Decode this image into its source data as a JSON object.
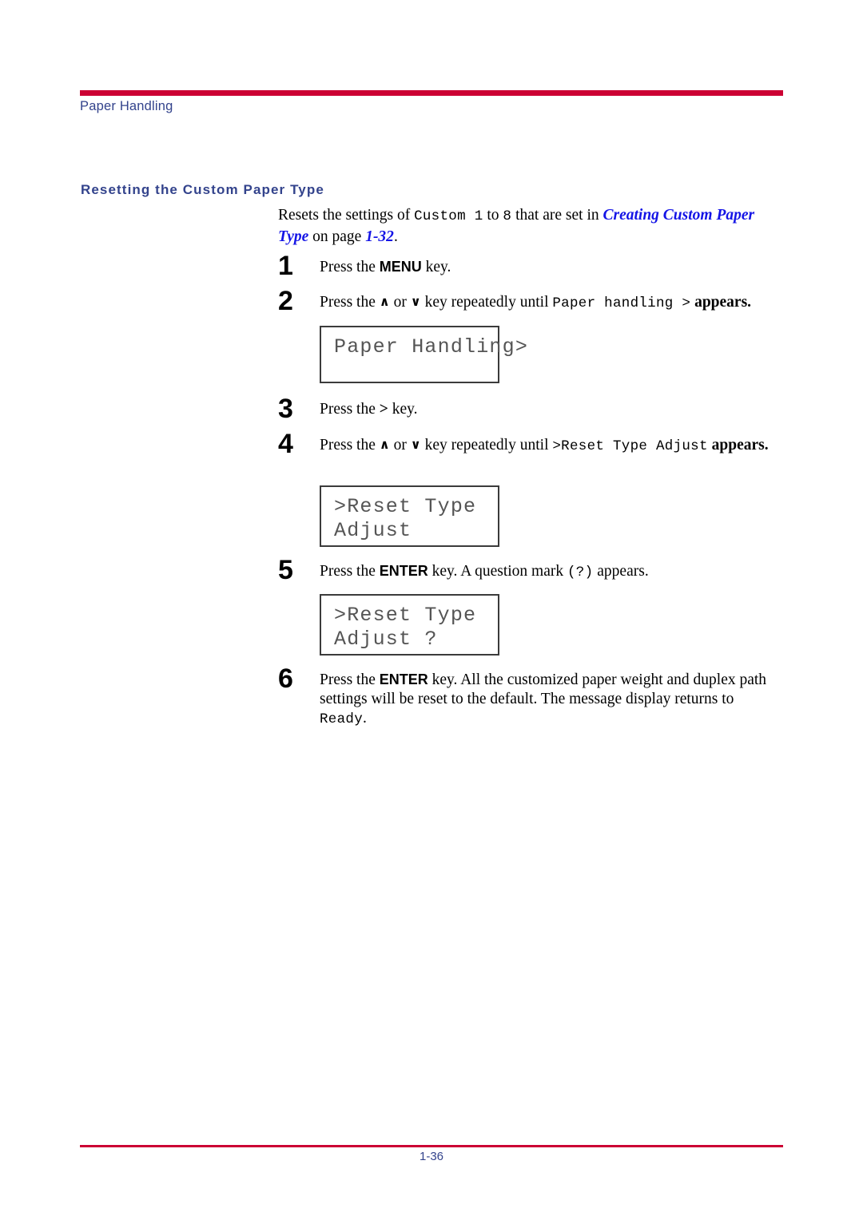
{
  "header": {
    "running_title": "Paper Handling",
    "rule_color": "#CC0033",
    "title_color": "#33438C"
  },
  "section": {
    "heading": "Resetting the Custom Paper Type",
    "heading_color": "#33438C"
  },
  "intro": {
    "text_1": "Resets the settings of ",
    "mono_1": "Custom 1",
    "text_2": " to ",
    "mono_2": "8",
    "text_3": " that are set in ",
    "xref_1": "Creating Custom Paper Type",
    "text_4": " on page ",
    "xref_2": "1-32",
    "text_5": ".",
    "xref_color": "#1414E6"
  },
  "steps": [
    {
      "number": "1",
      "text_1": "Press the ",
      "kbd": "MENU",
      "text_2": " key."
    },
    {
      "number": "2",
      "text_1": "Press the ",
      "chevron_up": "∧",
      "text_2": " or ",
      "chevron_down": "∨",
      "text_3": " key repeatedly until ",
      "mono": "Paper handling >",
      "text_4": " appears."
    },
    {
      "number": "3",
      "text_1": "Press the ",
      "kbd": ">",
      "text_2": " key."
    },
    {
      "number": "4",
      "text_1": "Press the ",
      "chevron_up": "∧",
      "text_2": " or ",
      "chevron_down": "∨",
      "text_3": " key repeatedly until ",
      "mono": ">Reset Type Adjust",
      "text_4": " appears."
    },
    {
      "number": "5",
      "text_1": "Press the ",
      "kbd": "ENTER",
      "text_2": " key. A question mark ",
      "mono": "(?)",
      "text_3": " appears."
    },
    {
      "number": "6",
      "text_1": "Press the ",
      "kbd": "ENTER",
      "text_2": " key. All the customized paper weight and duplex path settings will be reset to the default. The message display returns to ",
      "mono": "Ready",
      "text_3": "."
    }
  ],
  "displays": [
    {
      "line_1": "Paper Handling>",
      "line_2": ""
    },
    {
      "line_1": ">Reset Type",
      "line_2": "Adjust"
    },
    {
      "line_1": ">Reset Type",
      "line_2": "Adjust ?"
    }
  ],
  "footer": {
    "page_number": "1-36",
    "rule_color": "#CC0033",
    "text_color": "#33438C"
  }
}
